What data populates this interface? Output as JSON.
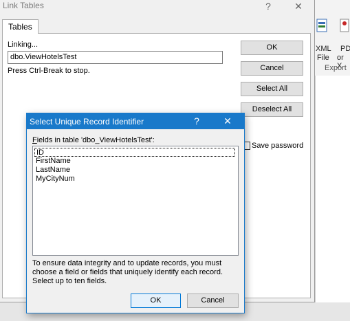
{
  "background_app": {
    "ribbon": {
      "xml_label_line1": "XML",
      "xml_label_line2": "File",
      "pdf_label_line1": "PD",
      "pdf_label_line2": "or X",
      "group_label": "Export"
    }
  },
  "link_dialog": {
    "title": "Link Tables",
    "help_glyph": "?",
    "close_glyph": "✕",
    "tab_label": "Tables",
    "linking_label": "Linking...",
    "linking_value": "dbo.ViewHotelsTest",
    "status_text": "Press Ctrl-Break to stop.",
    "ok_label": "OK",
    "cancel_label": "Cancel",
    "select_all_label": "Select All",
    "deselect_all_label": "Deselect All",
    "save_password_label": "Save password",
    "save_password_checked": false
  },
  "uri_dialog": {
    "title": "Select Unique Record Identifier",
    "help_glyph": "?",
    "close_glyph": "✕",
    "fields_label_prefix": "F",
    "fields_label_rest": "ields in table 'dbo_ViewHotelsTest':",
    "fields": [
      "ID",
      "FirstName",
      "LastName",
      "MyCityNum"
    ],
    "focused_field_index": 0,
    "help_text": "To ensure data integrity and to update records, you must choose a field or fields that uniquely identify each record. Select up to ten fields.",
    "ok_label": "OK",
    "cancel_label": "Cancel",
    "accent_color": "#1979ca"
  }
}
